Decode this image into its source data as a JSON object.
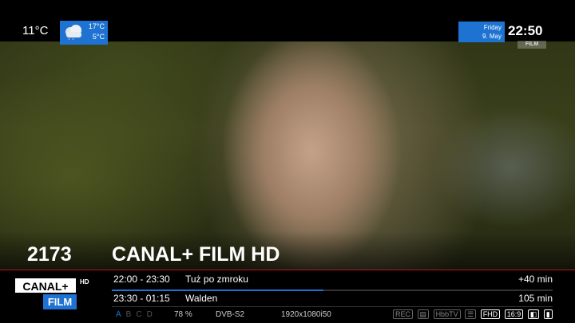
{
  "weather": {
    "current_temp": "11°C",
    "high": "17°C",
    "low": "5°C",
    "icon": "cloud-icon"
  },
  "clock": {
    "day": "Friday",
    "date": "9. May",
    "time": "22:50"
  },
  "watermark": {
    "text": "FILM"
  },
  "channel": {
    "number": "2173",
    "name": "CANAL+ FILM HD",
    "logo_top": "CANAL+",
    "logo_hd": "HD",
    "logo_bottom": "FILM"
  },
  "epg": {
    "now": {
      "time": "22:00 - 23:30",
      "title": "Tuż po zmroku",
      "remaining": "+40 min",
      "progress": 0.48
    },
    "next": {
      "time": "23:30 - 01:15",
      "title": "Walden",
      "duration": "105 min"
    }
  },
  "status_bar": {
    "colors": [
      "A",
      "B",
      "C",
      "D"
    ],
    "signal": "78 %",
    "tuner": "DVB-S2",
    "resolution": "1920x1080i50",
    "badges": [
      "REC",
      "HbbTV",
      "FHD",
      "16:9"
    ]
  },
  "colors": {
    "accent": "#1e73d2",
    "divider": "#c0121f"
  }
}
